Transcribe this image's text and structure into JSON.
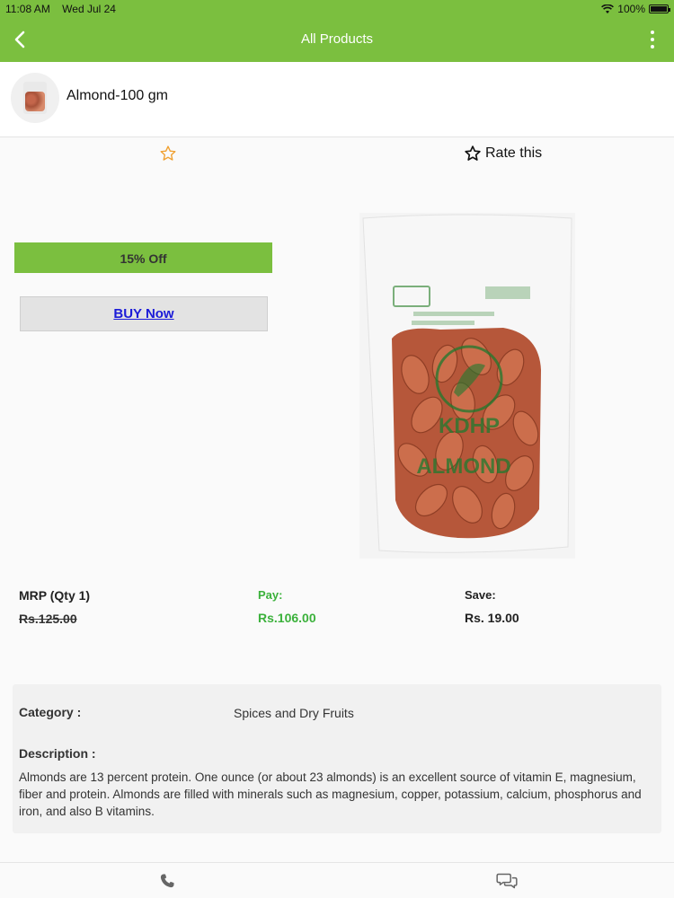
{
  "status_bar": {
    "time": "11:08 AM",
    "date": "Wed Jul 24",
    "battery_text": "100%",
    "battery_level": 1.0
  },
  "nav": {
    "title": "All Products",
    "back_icon": "chevron-left-icon",
    "menu_icon": "more-vertical-icon"
  },
  "product": {
    "name": "Almond-100 gm",
    "thumbnail_icon": "product-thumbnail"
  },
  "rating": {
    "star_icon": "star-outline-icon",
    "rate_label": "Rate this"
  },
  "offer": {
    "discount_label": "15% Off",
    "buy_label": "BUY Now"
  },
  "image_labels": {
    "brand": "KDHP",
    "product": "ALMOND"
  },
  "pricing": {
    "mrp_label": "MRP (Qty 1)",
    "mrp_value": "Rs.125.00",
    "pay_label": "Pay:",
    "pay_value": "Rs.106.00",
    "save_label": "Save:",
    "save_value": "Rs. 19.00"
  },
  "details": {
    "category_label": "Category :",
    "category_value": "Spices and Dry Fruits",
    "description_label": "Description :",
    "description_text": "Almonds are 13 percent protein. One ounce (or about 23 almonds) is an excellent source of vitamin E, magnesium, fiber and protein. Almonds are filled with minerals such as magnesium, copper, potassium, calcium, phosphorus and iron, and also B vitamins."
  },
  "bottom_bar": {
    "call_icon": "phone-icon",
    "chat_icon": "chat-bubbles-icon"
  },
  "colors": {
    "accent": "#7bbf3f",
    "pay_green": "#3bb13b",
    "link_blue": "#1b1bd8",
    "star_orange": "#f0a030"
  }
}
